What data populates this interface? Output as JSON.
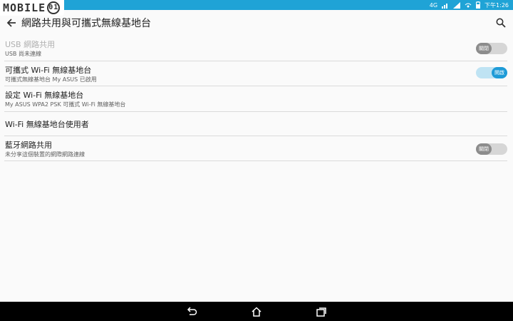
{
  "statusbar": {
    "brand_text": "MOBILE",
    "brand_tail": "01",
    "time": "下午1:26",
    "network": "4G"
  },
  "appbar": {
    "title": "網路共用與可攜式無線基地台"
  },
  "items": [
    {
      "title": "USB 網路共用",
      "subtitle": "USB 尚未連線",
      "toggle": "關閉",
      "state": "off",
      "disabled": true
    },
    {
      "title": "可攜式 Wi-Fi 無線基地台",
      "subtitle": "可攜式無線基地台 My ASUS 已啟用",
      "toggle": "開啟",
      "state": "on",
      "disabled": false
    },
    {
      "title": "設定 Wi-Fi 無線基地台",
      "subtitle": "My ASUS WPA2 PSK 可攜式 Wi-Fi 無線基地台",
      "toggle": null
    },
    {
      "title": "Wi-Fi 無線基地台使用者",
      "subtitle": null,
      "toggle": null
    },
    {
      "title": "藍牙網路共用",
      "subtitle": "未分享這個裝置的網際網路連線",
      "toggle": "關閉",
      "state": "off",
      "disabled": false
    }
  ],
  "colors": {
    "accent": "#1e9bd7",
    "statusbar": "#1fa3d6"
  }
}
